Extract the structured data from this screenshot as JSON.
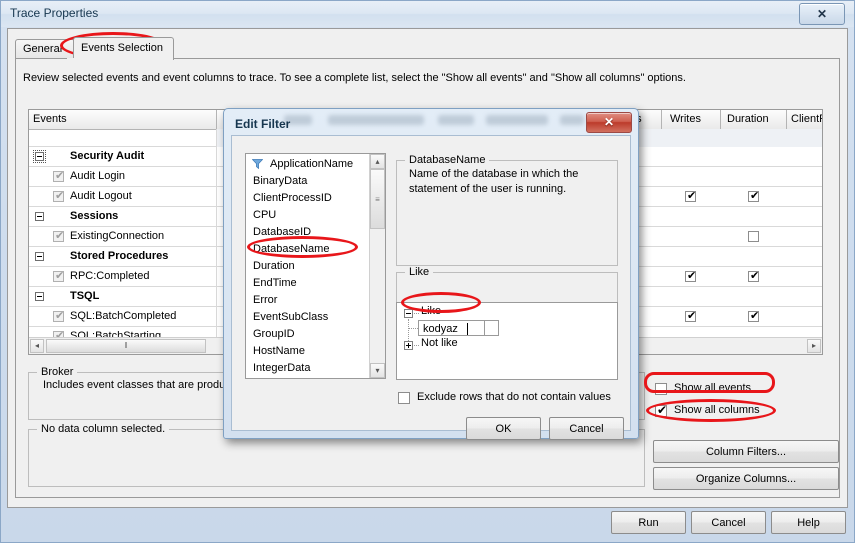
{
  "window": {
    "title": "Trace Properties",
    "close_glyph": "✕"
  },
  "tabs": [
    {
      "label": "General",
      "active": false
    },
    {
      "label": "Events Selection",
      "active": true
    }
  ],
  "description": "Review selected events and event columns to trace. To see a complete list, select the \"Show all events\" and \"Show all columns\" options.",
  "grid": {
    "headers": [
      "Events",
      "ds",
      "Writes",
      "Duration",
      "ClientProcess"
    ],
    "rows": [
      {
        "label": "Security Audit",
        "type": "group",
        "checked": null,
        "writes": null,
        "duration": null,
        "clientprocess": null
      },
      {
        "label": "Audit Login",
        "type": "event",
        "checked": true,
        "writes": null,
        "duration": null,
        "clientprocess": true
      },
      {
        "label": "Audit Logout",
        "type": "event",
        "checked": true,
        "writes": true,
        "duration": true,
        "clientprocess": true
      },
      {
        "label": "Sessions",
        "type": "group",
        "checked": null,
        "writes": null,
        "duration": null,
        "clientprocess": null
      },
      {
        "label": "ExistingConnection",
        "type": "event",
        "checked": true,
        "writes": null,
        "duration": false,
        "clientprocess": true
      },
      {
        "label": "Stored Procedures",
        "type": "group",
        "checked": null,
        "writes": null,
        "duration": null,
        "clientprocess": null
      },
      {
        "label": "RPC:Completed",
        "type": "event",
        "checked": true,
        "writes": true,
        "duration": true,
        "clientprocess": true
      },
      {
        "label": "TSQL",
        "type": "group",
        "checked": null,
        "writes": null,
        "duration": null,
        "clientprocess": null
      },
      {
        "label": "SQL:BatchCompleted",
        "type": "event",
        "checked": true,
        "writes": true,
        "duration": true,
        "clientprocess": true
      },
      {
        "label": "SQL:BatchStarting",
        "type": "event",
        "checked": true,
        "writes": null,
        "duration": null,
        "clientprocess": true
      }
    ],
    "hscroll": {
      "left_arrow": "◂",
      "right_arrow": "▸",
      "thumb_grip": "‖"
    }
  },
  "info_panels": {
    "broker": {
      "title": "Broker",
      "text": "Includes event classes that are produ"
    },
    "no_column": {
      "title": "No data column selected."
    }
  },
  "right_panel": {
    "show_all_events": {
      "label": "Show all events",
      "checked": false
    },
    "show_all_columns": {
      "label": "Show all columns",
      "checked": true,
      "tick": "✔"
    },
    "column_filters_button": "Column Filters...",
    "organize_columns_button": "Organize Columns..."
  },
  "footer": {
    "run_button": "Run",
    "cancel_button": "Cancel",
    "help_button": "Help"
  },
  "dialog": {
    "title": "Edit Filter",
    "close_glyph": "✕",
    "columns": [
      {
        "name": "ApplicationName",
        "filtered": true
      },
      {
        "name": "BinaryData",
        "filtered": false
      },
      {
        "name": "ClientProcessID",
        "filtered": false
      },
      {
        "name": "CPU",
        "filtered": false
      },
      {
        "name": "DatabaseID",
        "filtered": false
      },
      {
        "name": "DatabaseName",
        "filtered": false,
        "selected": true
      },
      {
        "name": "Duration",
        "filtered": false
      },
      {
        "name": "EndTime",
        "filtered": false
      },
      {
        "name": "Error",
        "filtered": false
      },
      {
        "name": "EventSubClass",
        "filtered": false
      },
      {
        "name": "GroupID",
        "filtered": false
      },
      {
        "name": "HostName",
        "filtered": false
      },
      {
        "name": "IntegerData",
        "filtered": false
      }
    ],
    "scrollbar": {
      "up_arrow": "▴",
      "down_arrow": "▾",
      "thumb_grip": "≡"
    },
    "detail": {
      "title": "DatabaseName",
      "line1": "Name of the database in which the",
      "line2": "statement of the user is running."
    },
    "filter_tree": {
      "title": "Like",
      "like_label": "Like",
      "like_value": "kodyaz",
      "not_like_label": "Not like"
    },
    "exclude_checkbox": {
      "label": "Exclude rows that do not contain values",
      "checked": false
    },
    "ok_button": "OK",
    "cancel_button": "Cancel"
  },
  "annotations": {
    "color": "#e8161a",
    "targets": [
      "events-selection-tab",
      "database-name-list-item",
      "like-value-field",
      "show-all-columns-checkbox",
      "column-filters-button"
    ]
  }
}
